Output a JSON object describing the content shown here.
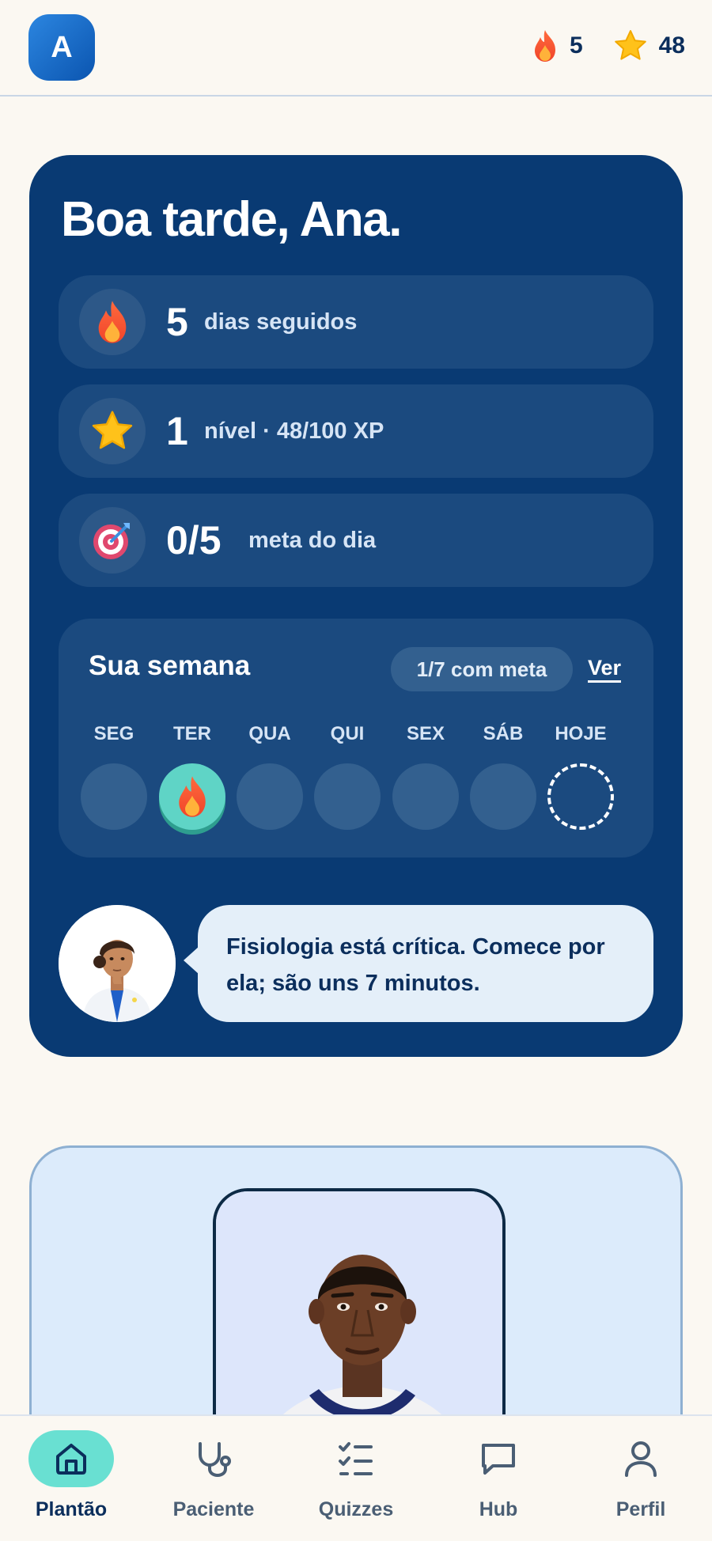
{
  "header": {
    "avatar_initial": "A",
    "streak_count": "5",
    "xp_count": "48"
  },
  "hero": {
    "greeting": "Boa tarde, Ana.",
    "stats": [
      {
        "icon": "flame-icon",
        "value": "5",
        "label": "dias seguidos"
      },
      {
        "icon": "star-icon",
        "value": "1",
        "label": "nível · 48/100 XP"
      },
      {
        "icon": "target-icon",
        "value": "0/5",
        "label": "meta do dia"
      }
    ],
    "week": {
      "title": "Sua semana",
      "summary": "1/7 com meta",
      "link": "Ver",
      "days": [
        {
          "label": "SEG",
          "state": "empty"
        },
        {
          "label": "TER",
          "state": "done"
        },
        {
          "label": "QUA",
          "state": "empty"
        },
        {
          "label": "QUI",
          "state": "empty"
        },
        {
          "label": "SEX",
          "state": "empty"
        },
        {
          "label": "SÁB",
          "state": "empty"
        },
        {
          "label": "HOJE",
          "state": "today"
        }
      ]
    },
    "tip": "Fisiologia está crítica. Comece por ela; são uns 7 minutos."
  },
  "nav": {
    "items": [
      {
        "label": "Plantão",
        "icon": "home-icon",
        "active": true
      },
      {
        "label": "Paciente",
        "icon": "stethoscope-icon",
        "active": false
      },
      {
        "label": "Quizzes",
        "icon": "checklist-icon",
        "active": false
      },
      {
        "label": "Hub",
        "icon": "chat-icon",
        "active": false
      },
      {
        "label": "Perfil",
        "icon": "user-icon",
        "active": false
      }
    ]
  },
  "colors": {
    "background": "#FBF8F2",
    "hero": "#093A73",
    "accent": "#69E0D2",
    "text": "#0B2E5C"
  }
}
